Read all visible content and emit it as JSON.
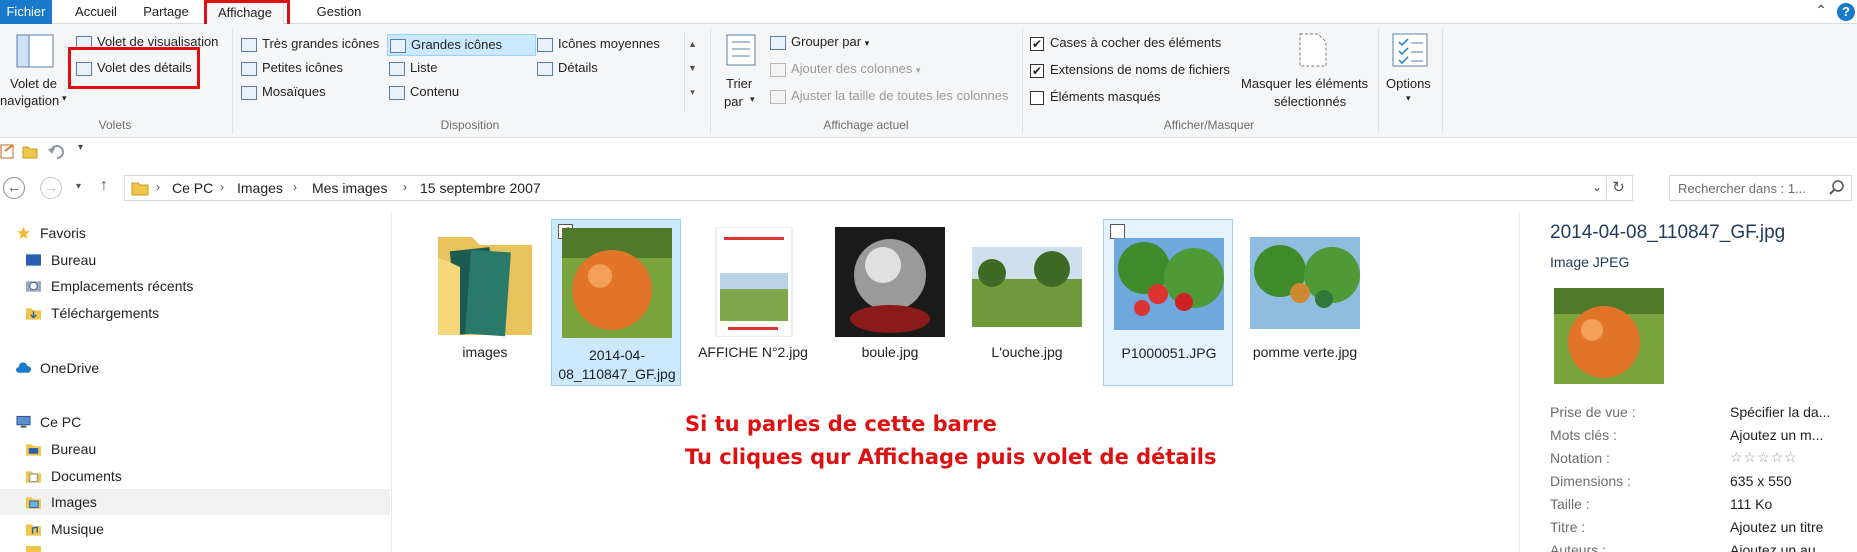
{
  "ribbon_tabs": [
    "Fichier",
    "Accueil",
    "Partage",
    "Affichage",
    "Gestion"
  ],
  "help_label": "?",
  "panes_group": {
    "nav_pane_line1": "Volet de",
    "nav_pane_line2": "navigation",
    "preview_pane": "Volet de visualisation",
    "details_pane": "Volet des détails",
    "label": "Volets"
  },
  "layout_group": {
    "items": [
      "Très grandes icônes",
      "Grandes icônes",
      "Icônes moyennes",
      "Petites icônes",
      "Liste",
      "Détails",
      "Mosaïques",
      "Contenu"
    ],
    "selected": "Grandes icônes",
    "label": "Disposition"
  },
  "current_view_group": {
    "sort_line1": "Trier",
    "sort_line2": "par",
    "group_by": "Grouper par",
    "add_columns": "Ajouter des colonnes",
    "size_columns": "Ajuster la taille de toutes les colonnes",
    "label": "Affichage actuel"
  },
  "show_hide_group": {
    "checkboxes": [
      {
        "label": "Cases à cocher des éléments",
        "checked": "✔"
      },
      {
        "label": "Extensions de noms de fichiers",
        "checked": "✔"
      },
      {
        "label": "Éléments masqués",
        "checked": ""
      }
    ],
    "hide_selected_line1": "Masquer les éléments",
    "hide_selected_line2": "sélectionnés",
    "label": "Afficher/Masquer"
  },
  "options_label": "Options",
  "address": {
    "crumbs": [
      "Ce PC",
      "Images",
      "Mes images",
      "15 septembre 2007"
    ],
    "search_placeholder": "Rechercher dans : 1..."
  },
  "nav_pane": [
    {
      "label": "Favoris"
    },
    {
      "label": "Bureau"
    },
    {
      "label": "Emplacements récents"
    },
    {
      "label": "Téléchargements"
    },
    {
      "label": "OneDrive"
    },
    {
      "label": "Ce PC"
    },
    {
      "label": "Bureau"
    },
    {
      "label": "Documents"
    },
    {
      "label": "Images"
    },
    {
      "label": "Musique"
    }
  ],
  "files": [
    {
      "name": "images",
      "checked": ""
    },
    {
      "name": "2014-04-08_110847_GF.jpg",
      "checked": "✔"
    },
    {
      "name": "AFFICHE N°2.jpg",
      "checked": ""
    },
    {
      "name": "boule.jpg",
      "checked": ""
    },
    {
      "name": "L'ouche.jpg",
      "checked": ""
    },
    {
      "name": "P1000051.JPG",
      "checked": ""
    },
    {
      "name": "pomme verte.jpg",
      "checked": ""
    }
  ],
  "annotation": {
    "line1": "Si tu parles de cette barre",
    "line2": "Tu cliques qur Affichage puis volet de détails"
  },
  "details": {
    "title": "2014-04-08_110847_GF.jpg",
    "type": "Image JPEG",
    "properties": [
      {
        "label": "Prise de vue :",
        "value": "Spécifier la da..."
      },
      {
        "label": "Mots clés :",
        "value": "Ajoutez un m..."
      },
      {
        "label": "Notation :",
        "value": "☆☆☆☆☆"
      },
      {
        "label": "Dimensions :",
        "value": "635 x 550"
      },
      {
        "label": "Taille :",
        "value": "111 Ko"
      },
      {
        "label": "Titre :",
        "value": "Ajoutez un titre"
      },
      {
        "label": "Auteurs :",
        "value": "Ajoutez un au..."
      }
    ]
  },
  "colors": {
    "accent": "#1979ca",
    "selection": "#cce8ff",
    "highlight_box": "#e01010",
    "annotation": "#dd1111"
  }
}
